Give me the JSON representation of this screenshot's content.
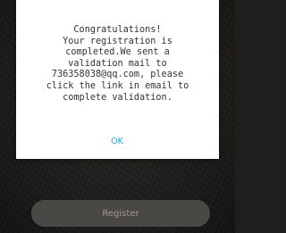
{
  "dialog": {
    "message": "Congratulations!\nYour registration is\ncompleted.We sent a\nvalidation mail to\n736358038@qq.com, please\nclick the link in email to\ncomplete validation.",
    "ok_label": "OK",
    "ok_color": "#1fa6e8"
  },
  "form": {
    "register_label": "Register"
  }
}
